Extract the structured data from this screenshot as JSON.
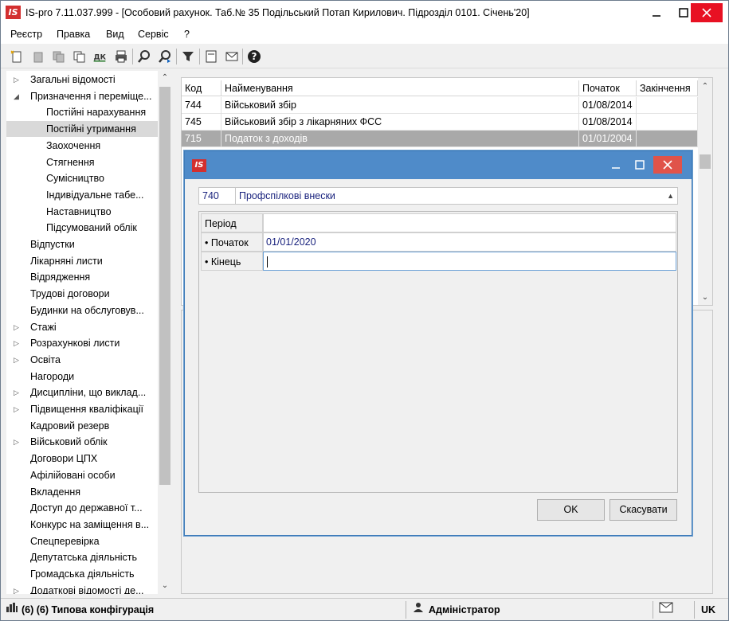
{
  "window": {
    "title": "IS-pro 7.11.037.999 - [Особовий рахунок. Таб.№ 35 Подільський Потап Кирилович. Підрозділ 0101. Січень'20]",
    "logo_text": "IS"
  },
  "menu": [
    "Реєстр",
    "Правка",
    "Вид",
    "Сервіс",
    "?"
  ],
  "toolbar": {
    "icons": [
      "new-doc-icon",
      "edit-icon",
      "copy-icon",
      "duplicate-icon",
      "dk-icon",
      "print-icon",
      "find-icon",
      "find-next-icon",
      "filter-icon",
      "form-icon",
      "mail-icon",
      "help-icon"
    ],
    "dk_label": "ДК"
  },
  "tree": {
    "items": [
      {
        "label": "Загальні відомості",
        "level": 0,
        "arrow": "▷"
      },
      {
        "label": "Призначення і переміще...",
        "level": 0,
        "arrow": "◢"
      },
      {
        "label": "Постійні нарахування",
        "level": 1,
        "arrow": ""
      },
      {
        "label": "Постійні утримання",
        "level": 1,
        "arrow": "",
        "selected": true
      },
      {
        "label": "Заохочення",
        "level": 1,
        "arrow": ""
      },
      {
        "label": "Стягнення",
        "level": 1,
        "arrow": ""
      },
      {
        "label": "Сумісництво",
        "level": 1,
        "arrow": ""
      },
      {
        "label": "Індивідуальне табе...",
        "level": 1,
        "arrow": ""
      },
      {
        "label": "Наставництво",
        "level": 1,
        "arrow": ""
      },
      {
        "label": "Підсумований облік",
        "level": 1,
        "arrow": ""
      },
      {
        "label": "Відпустки",
        "level": 0,
        "arrow": ""
      },
      {
        "label": "Лікарняні листи",
        "level": 0,
        "arrow": ""
      },
      {
        "label": "Відрядження",
        "level": 0,
        "arrow": ""
      },
      {
        "label": "Трудові договори",
        "level": 0,
        "arrow": ""
      },
      {
        "label": "Будинки на обслуговув...",
        "level": 0,
        "arrow": ""
      },
      {
        "label": "Стажі",
        "level": 0,
        "arrow": "▷"
      },
      {
        "label": "Розрахункові листи",
        "level": 0,
        "arrow": "▷"
      },
      {
        "label": "Освіта",
        "level": 0,
        "arrow": "▷"
      },
      {
        "label": "Нагороди",
        "level": 0,
        "arrow": ""
      },
      {
        "label": "Дисципліни, що виклад...",
        "level": 0,
        "arrow": "▷"
      },
      {
        "label": "Підвищення кваліфікації",
        "level": 0,
        "arrow": "▷"
      },
      {
        "label": "Кадровий резерв",
        "level": 0,
        "arrow": ""
      },
      {
        "label": "Військовий облік",
        "level": 0,
        "arrow": "▷"
      },
      {
        "label": "Договори ЦПХ",
        "level": 0,
        "arrow": ""
      },
      {
        "label": "Афілійовані особи",
        "level": 0,
        "arrow": ""
      },
      {
        "label": "Вкладення",
        "level": 0,
        "arrow": ""
      },
      {
        "label": "Доступ до державної т...",
        "level": 0,
        "arrow": ""
      },
      {
        "label": "Конкурс на заміщення в...",
        "level": 0,
        "arrow": ""
      },
      {
        "label": "Спецперевірка",
        "level": 0,
        "arrow": ""
      },
      {
        "label": "Депутатська діяльність",
        "level": 0,
        "arrow": ""
      },
      {
        "label": "Громадська діяльність",
        "level": 0,
        "arrow": ""
      },
      {
        "label": "Додаткові відомості де...",
        "level": 0,
        "arrow": "▷"
      }
    ]
  },
  "grid": {
    "columns": [
      "Код",
      "Найменування",
      "Початок",
      "Закінчення"
    ],
    "rows": [
      {
        "code": "744",
        "name": "Військовий збір",
        "start": "01/08/2014",
        "end": ""
      },
      {
        "code": "745",
        "name": "Військовий збір з лікарняних ФСС",
        "start": "01/08/2014",
        "end": ""
      },
      {
        "code": "715",
        "name": "Податок з доходів",
        "start": "01/01/2004",
        "end": "",
        "selected": true
      }
    ]
  },
  "dialog": {
    "logo_text": "IS",
    "combo": {
      "code": "740",
      "name": "Профспілкові внески"
    },
    "props": [
      {
        "label": "Період",
        "value": ""
      },
      {
        "label": "• Початок",
        "value": "01/01/2020"
      },
      {
        "label": "• Кінець",
        "value": ""
      }
    ],
    "ok_label": "OK",
    "cancel_label": "Скасувати"
  },
  "status": {
    "config": "(6) (6) Типова конфігурація",
    "user": "Адміністратор",
    "lang": "UK"
  }
}
